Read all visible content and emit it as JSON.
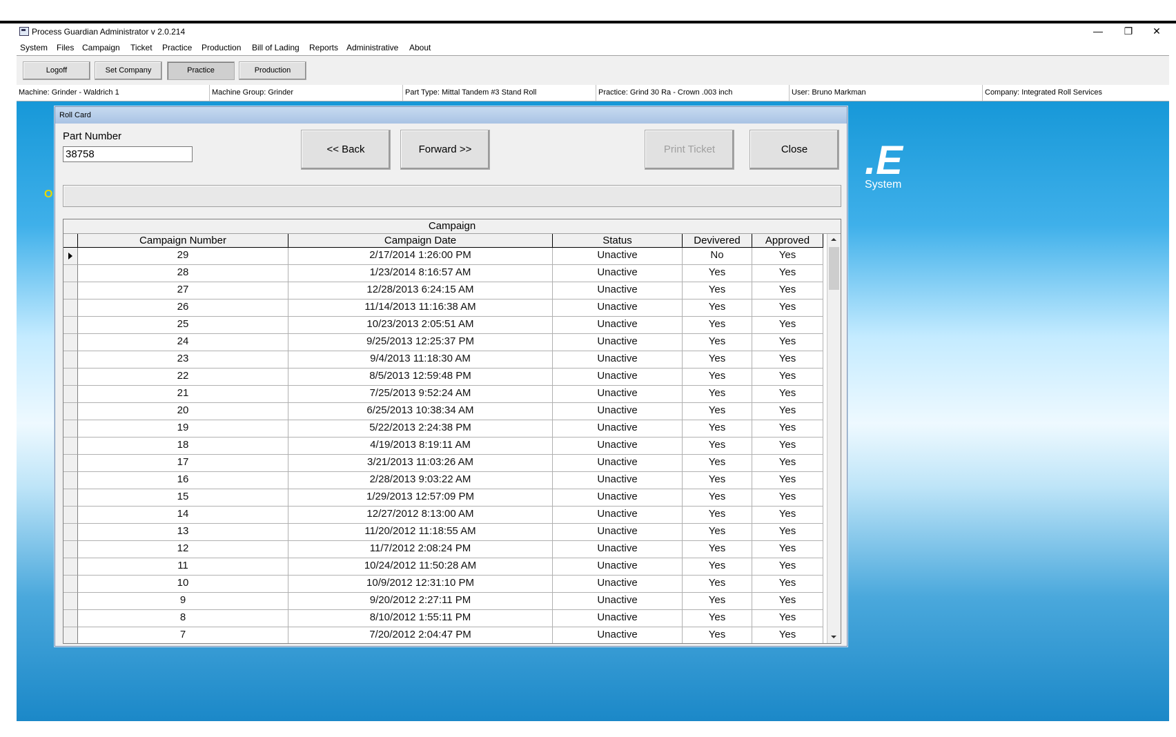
{
  "window": {
    "title": "Process Guardian Administrator  v 2.0.214"
  },
  "menu": [
    "System",
    "Files",
    "Campaign",
    "Ticket",
    "Practice",
    "Production",
    "Bill of Lading",
    "Reports",
    "Administrative",
    "About"
  ],
  "toolbar": {
    "logoff": "Logoff",
    "set_company": "Set Company",
    "practice": "Practice",
    "production": "Production"
  },
  "status": {
    "machine": "Machine: Grinder - Waldrich 1",
    "machine_group": "Machine Group: Grinder",
    "part_type": "Part Type: Mittal Tandem #3 Stand Roll",
    "practice": "Practice: Grind 30 Ra - Crown .003 inch",
    "user": "User: Bruno Markman",
    "company": "Company: Integrated Roll Services"
  },
  "background": {
    "logo_fragment": ".E",
    "logo_subtext": "System",
    "left_mark": "O"
  },
  "dialog": {
    "title": "Roll Card",
    "part_label": "Part Number",
    "part_value": "38758",
    "back": "<< Back",
    "forward": "Forward >>",
    "print": "Print Ticket",
    "close": "Close",
    "grid_caption": "Campaign",
    "columns": [
      "Campaign Number",
      "Campaign Date",
      "Status",
      "Devivered",
      "Approved"
    ],
    "rows": [
      [
        "29",
        "2/17/2014 1:26:00 PM",
        "Unactive",
        "No",
        "Yes"
      ],
      [
        "28",
        "1/23/2014 8:16:57 AM",
        "Unactive",
        "Yes",
        "Yes"
      ],
      [
        "27",
        "12/28/2013 6:24:15 AM",
        "Unactive",
        "Yes",
        "Yes"
      ],
      [
        "26",
        "11/14/2013 11:16:38 AM",
        "Unactive",
        "Yes",
        "Yes"
      ],
      [
        "25",
        "10/23/2013 2:05:51 AM",
        "Unactive",
        "Yes",
        "Yes"
      ],
      [
        "24",
        "9/25/2013 12:25:37 PM",
        "Unactive",
        "Yes",
        "Yes"
      ],
      [
        "23",
        "9/4/2013 11:18:30 AM",
        "Unactive",
        "Yes",
        "Yes"
      ],
      [
        "22",
        "8/5/2013 12:59:48 PM",
        "Unactive",
        "Yes",
        "Yes"
      ],
      [
        "21",
        "7/25/2013 9:52:24 AM",
        "Unactive",
        "Yes",
        "Yes"
      ],
      [
        "20",
        "6/25/2013 10:38:34 AM",
        "Unactive",
        "Yes",
        "Yes"
      ],
      [
        "19",
        "5/22/2013 2:24:38 PM",
        "Unactive",
        "Yes",
        "Yes"
      ],
      [
        "18",
        "4/19/2013 8:19:11 AM",
        "Unactive",
        "Yes",
        "Yes"
      ],
      [
        "17",
        "3/21/2013 11:03:26 AM",
        "Unactive",
        "Yes",
        "Yes"
      ],
      [
        "16",
        "2/28/2013 9:03:22 AM",
        "Unactive",
        "Yes",
        "Yes"
      ],
      [
        "15",
        "1/29/2013 12:57:09 PM",
        "Unactive",
        "Yes",
        "Yes"
      ],
      [
        "14",
        "12/27/2012 8:13:00 AM",
        "Unactive",
        "Yes",
        "Yes"
      ],
      [
        "13",
        "11/20/2012 11:18:55 AM",
        "Unactive",
        "Yes",
        "Yes"
      ],
      [
        "12",
        "11/7/2012 2:08:24 PM",
        "Unactive",
        "Yes",
        "Yes"
      ],
      [
        "11",
        "10/24/2012 11:50:28 AM",
        "Unactive",
        "Yes",
        "Yes"
      ],
      [
        "10",
        "10/9/2012 12:31:10 PM",
        "Unactive",
        "Yes",
        "Yes"
      ],
      [
        "9",
        "9/20/2012 2:27:11 PM",
        "Unactive",
        "Yes",
        "Yes"
      ],
      [
        "8",
        "8/10/2012 1:55:11 PM",
        "Unactive",
        "Yes",
        "Yes"
      ],
      [
        "7",
        "7/20/2012 2:04:47 PM",
        "Unactive",
        "Yes",
        "Yes"
      ]
    ]
  }
}
